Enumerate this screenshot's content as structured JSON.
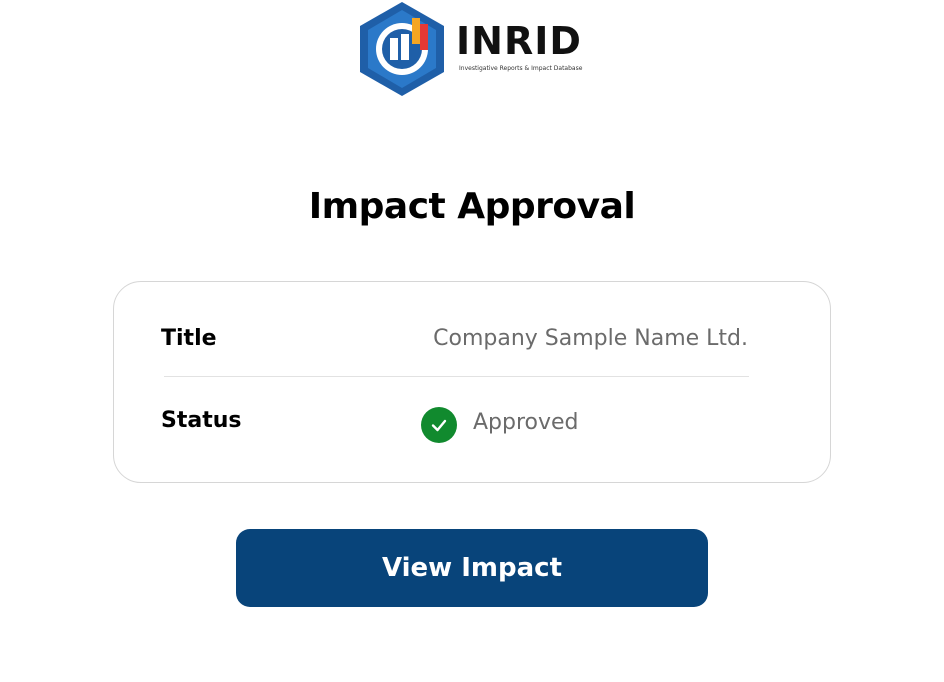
{
  "logo": {
    "word": "INRID",
    "tagline": "Investigative Reports & Impact Database"
  },
  "heading": "Impact Approval",
  "details": {
    "title_label": "Title",
    "title_value": "Company Sample Name Ltd.",
    "status_label": "Status",
    "status_value": "Approved",
    "status_icon": "check-circle-icon"
  },
  "action": {
    "label": "View Impact"
  },
  "colors": {
    "button": "#08447a",
    "status_success": "#118a2e",
    "logo_blue": "#1f5fa8"
  }
}
